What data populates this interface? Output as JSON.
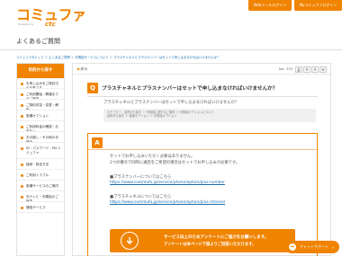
{
  "header": {
    "logo": "コミュファ",
    "logo_sub": "Powered by",
    "logo_brand": "ctc",
    "buttons": [
      "Webメールログイン",
      "Myコミュファログイン"
    ]
  },
  "page_title": "よくあるご質問",
  "breadcrumb": "コミュファ光トップ ＞ よくあるご質問 ＞ 光電話サービスについて ＞ プラスチャネルとプラスナンバーはセットで申し込まなければいけませんか？",
  "sidebar": {
    "heading": "目的から探す",
    "items": [
      "お申し込みをご検討中のお客さま",
      "ご利用開始・開通までのご案内",
      "ご契約内容・変更・解約",
      "各種オプション",
      "ご利用料金の確認・お支払い",
      "お引越し・その他の手続き",
      "ID・パスワード・Myコミュファ",
      "接続・設定方法",
      "ご利用トラブル",
      "各種サービスのご案内",
      "光テレビ・光電話のご案内",
      "通信サービス"
    ]
  },
  "main": {
    "back": "戻る",
    "faq_no": "No：370",
    "question_badge": "Q",
    "question_title": "プラスチャネルとプラスナンバーはセットで申し込まなければいけませんか？",
    "question_body": "プラスチャネルとプラスナンバーはセットで申し込まなければいけませんか？",
    "category": [
      "カテゴリー：目的から探す ＞ 光電話に関するご案内 ＞ 光電話オプションについて",
      "目的から探す ＞ 各種オプション ＞ 光電話オプション"
    ],
    "answer_badge": "A",
    "answer_lines": [
      "セットでお申し込みいただく必要はありません。",
      "2つの番号で同時に通話をご希望の場合はセットでお申し込みが必要です。"
    ],
    "plus_number_label": "■プラスナンバーについてはこちら",
    "plus_number_link": "https://www.commufa.jp/service/phone/option/plus-number",
    "plus_channel_label": "■プラスチャネルについてはこちら",
    "plus_channel_link": "https://www.commufa.jp/service/phone/option/plus-channel",
    "survey_l1": "サービス向上のためアンケートにご協力をお願いします。",
    "survey_l2": "アンケートは本ページ下部よりご回答いただけます。"
  },
  "chat": "チャットサポート",
  "colors": {
    "accent": "#f08300",
    "link": "#1a6fb0"
  }
}
